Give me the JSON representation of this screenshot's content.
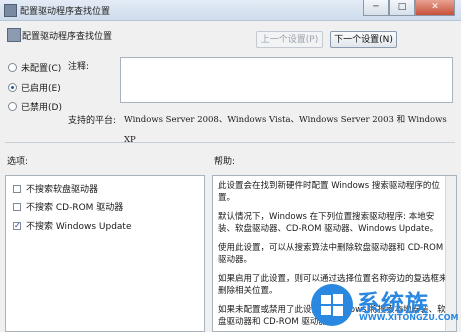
{
  "window": {
    "title": "配置驱动程序查找位置"
  },
  "header": {
    "title": "配置驱动程序查找位置",
    "prev_label": "上一个设置(P)",
    "next_label": "下一个设置(N)"
  },
  "state": {
    "options": [
      {
        "label": "未配置(C)",
        "selected": false
      },
      {
        "label": "已启用(E)",
        "selected": true
      },
      {
        "label": "已禁用(D)",
        "selected": false
      }
    ]
  },
  "comment": {
    "label": "注释:",
    "value": ""
  },
  "platform": {
    "label": "支持的平台:",
    "value": "Windows Server 2008、Windows Vista、Windows Server 2003 和 Windows XP"
  },
  "options_section": {
    "label": "选项:",
    "items": [
      {
        "label": "不搜索软盘驱动器",
        "checked": false
      },
      {
        "label": "不搜索 CD-ROM 驱动器",
        "checked": false
      },
      {
        "label": "不搜索 Windows Update",
        "checked": true
      }
    ]
  },
  "help_section": {
    "label": "帮助:",
    "paragraphs": [
      "此设置会在找到新硬件时配置 Windows 搜索驱动程序的位置。",
      "默认情况下，Windows 在下列位置搜索驱动程序: 本地安装、软盘驱动器、CD-ROM 驱动器、Windows Update。",
      "使用此设置，可以从搜索算法中删除软盘驱动器和 CD-ROM 驱动器。",
      "如果启用了此设置，则可以通过选择位置名称旁边的复选框来删除相关位置。",
      "如果未配置或禁用了此设置，Windows 将搜索本地安装、软盘驱动器和 CD-ROM 驱动器。"
    ]
  },
  "watermark": {
    "brand": "系统族",
    "url": "WWW.XITONGZU.COM"
  },
  "colors": {
    "accent": "#2a88e0",
    "titlebar": "#dce6f2",
    "close": "#c6503a"
  }
}
